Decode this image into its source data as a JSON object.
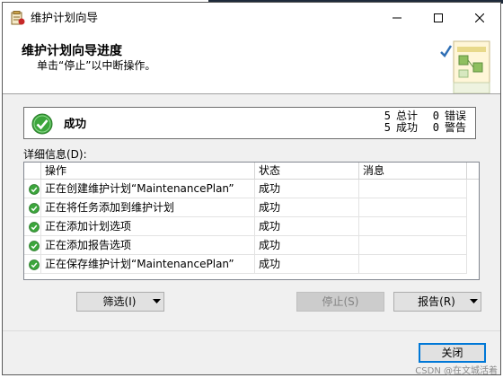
{
  "window": {
    "title": "维护计划向导"
  },
  "header": {
    "title": "维护计划向导进度",
    "subtitle": "单击“停止”以中断操作。"
  },
  "status": {
    "result": "成功",
    "counts": {
      "total_num": "5",
      "total_label": "总计",
      "success_num": "5",
      "success_label": "成功",
      "error_num": "0",
      "error_label": "错误",
      "warning_num": "0",
      "warning_label": "警告"
    }
  },
  "details": {
    "label": "详细信息(D):",
    "columns": [
      "操作",
      "状态",
      "消息"
    ],
    "rows": [
      {
        "action": "正在创建维护计划“MaintenancePlan”",
        "status": "成功",
        "message": ""
      },
      {
        "action": "正在将任务添加到维护计划",
        "status": "成功",
        "message": ""
      },
      {
        "action": "正在添加计划选项",
        "status": "成功",
        "message": ""
      },
      {
        "action": "正在添加报告选项",
        "status": "成功",
        "message": ""
      },
      {
        "action": "正在保存维护计划“MaintenancePlan”",
        "status": "成功",
        "message": ""
      }
    ]
  },
  "buttons": {
    "filter": "筛选(I)",
    "stop": "停止(S)",
    "report": "报告(R)",
    "close": "关闭"
  },
  "watermark": "CSDN @在文城活着",
  "colors": {
    "success_green": "#3ca63c",
    "accent_blue": "#0078d7",
    "disabled_gray": "#cccccc"
  }
}
